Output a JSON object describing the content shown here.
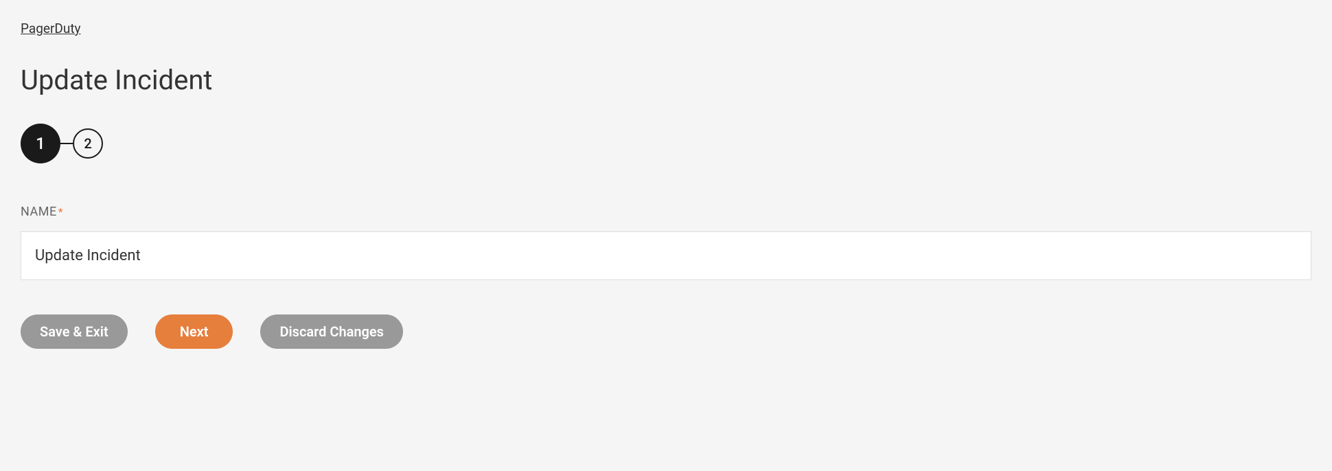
{
  "breadcrumb": {
    "label": "PagerDuty"
  },
  "page": {
    "title": "Update Incident"
  },
  "stepper": {
    "steps": [
      {
        "label": "1",
        "active": true
      },
      {
        "label": "2",
        "active": false
      }
    ]
  },
  "form": {
    "name": {
      "label": "NAME",
      "required_marker": "*",
      "value": "Update Incident"
    }
  },
  "buttons": {
    "save_exit": "Save & Exit",
    "next": "Next",
    "discard": "Discard Changes"
  }
}
